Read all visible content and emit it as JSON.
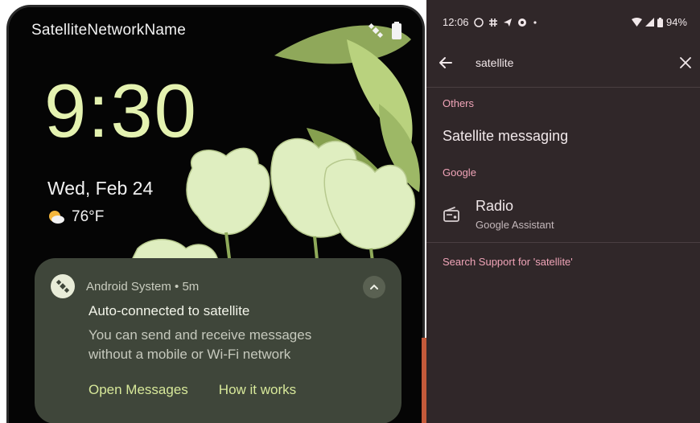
{
  "lockscreen": {
    "carrier": "SatelliteNetworkName",
    "time": "9:30",
    "date": "Wed, Feb 24",
    "temperature": "76°F",
    "notification": {
      "app": "Android System • 5m",
      "title": "Auto-connected to satellite",
      "body": "You can send and receive messages without a mobile or Wi-Fi network",
      "actions": [
        "Open Messages",
        "How it works"
      ]
    }
  },
  "settings_search": {
    "status": {
      "time": "12:06",
      "battery": "94%"
    },
    "query": "satellite",
    "sections": [
      {
        "header": "Others",
        "items": [
          {
            "title": "Satellite messaging"
          }
        ]
      },
      {
        "header": "Google",
        "items": [
          {
            "title": "Radio",
            "subtitle": "Google Assistant"
          }
        ]
      }
    ],
    "support_link": "Search Support for 'satellite'"
  },
  "colors": {
    "clock": "#e4f2b0",
    "notification_bg": "#3f463a",
    "accent_action": "#d7e89a",
    "settings_bg": "#302729",
    "section_header": "#f0a4b8"
  }
}
